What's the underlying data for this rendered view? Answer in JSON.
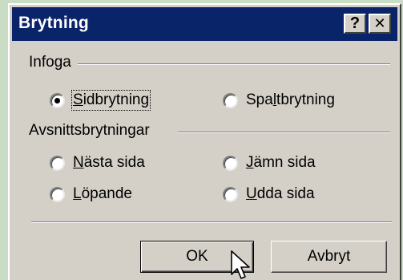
{
  "dialog": {
    "title": "Brytning",
    "help_button": "?",
    "close_button": "✕"
  },
  "insert_group": {
    "heading": "Infoga",
    "options": [
      {
        "label": "Sidbrytning",
        "selected": true
      },
      {
        "label": "Spaltbrytning",
        "selected": false
      }
    ]
  },
  "section_group": {
    "heading": "Avsnittsbrytningar",
    "options": [
      {
        "label": "Nästa sida",
        "selected": false
      },
      {
        "label": "Jämn sida",
        "selected": false
      },
      {
        "label": "Löpande",
        "selected": false
      },
      {
        "label": "Udda sida",
        "selected": false
      }
    ]
  },
  "buttons": {
    "ok": "OK",
    "cancel": "Avbryt"
  },
  "colors": {
    "titlebar": "#0a246a",
    "face": "#d4d0c8",
    "background": "#c9dcc4"
  }
}
